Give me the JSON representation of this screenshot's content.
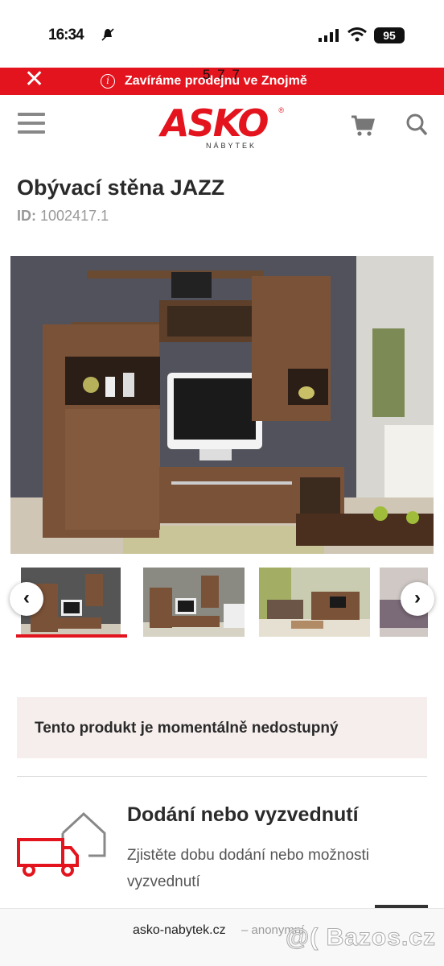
{
  "status_bar": {
    "time": "16:34",
    "battery": "95"
  },
  "promo": {
    "text": "Zavíráme prodejnu ve Znojmě",
    "counter": "5 7 7"
  },
  "header": {
    "logo_text": "ASKO",
    "logo_sub": "NÁBYTEK",
    "logo_reg": "®"
  },
  "product": {
    "title": "Obývací stěna JAZZ",
    "id_label": "ID:",
    "id_value": "1002417.1"
  },
  "gallery": {
    "prev": "‹",
    "next": "›"
  },
  "availability": {
    "text": "Tento produkt je momentálně nedostupný"
  },
  "delivery": {
    "title": "Dodání nebo vyzvednutí",
    "description": "Zjistěte dobu dodání nebo možnosti vyzvednutí"
  },
  "browser": {
    "url": "asko-nabytek.cz",
    "mode": "– anonymní"
  },
  "watermark": "@( Bazos.cz",
  "colors": {
    "brand_red": "#e3141e",
    "unavailable_bg": "#f6eded"
  }
}
